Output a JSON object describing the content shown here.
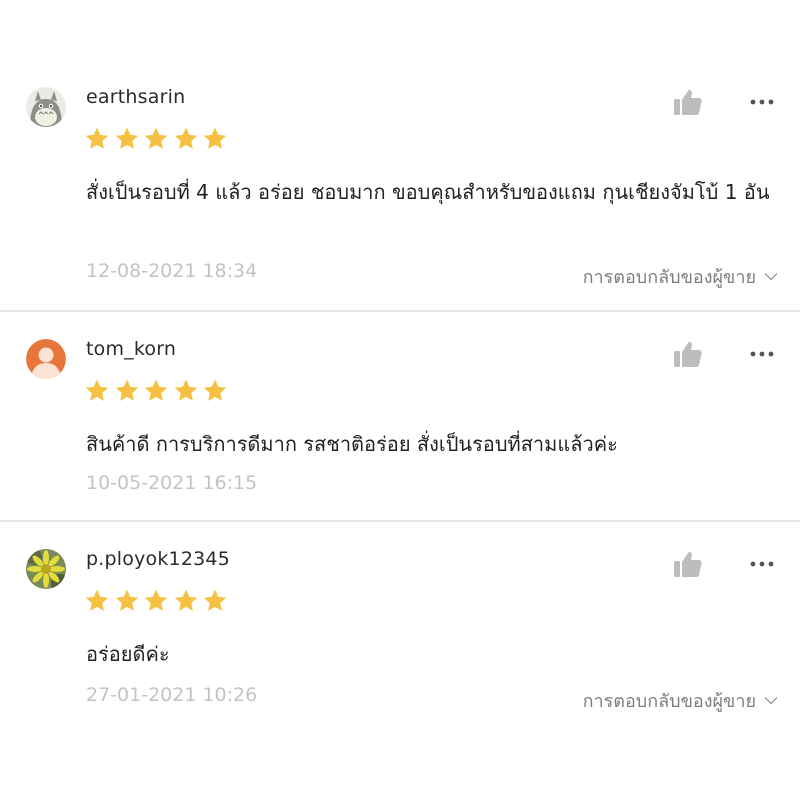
{
  "reviews": [
    {
      "username": "earthsarin",
      "rating": 5,
      "comment": "สั่งเป็นรอบที่ 4 แล้ว อร่อย ชอบมาก ขอบคุณสำหรับของแถม กุนเชียงจัมโบ้ 1 อัน",
      "timestamp": "12-08-2021 18:34",
      "seller_reply_label": "การตอบกลับของผู้ขาย",
      "avatar_icon": "totoro-avatar-icon"
    },
    {
      "username": "tom_korn",
      "rating": 5,
      "comment": "สินค้าดี การบริการดีมาก รสชาติอร่อย สั่งเป็นรอบที่สามแล้วค่ะ",
      "timestamp": "10-05-2021 16:15",
      "avatar_icon": "default-user-avatar-icon"
    },
    {
      "username": "p.ployok12345",
      "rating": 5,
      "comment": "อร่อยดีค่ะ",
      "timestamp": "27-01-2021 10:26",
      "seller_reply_label": "การตอบกลับของผู้ขาย",
      "avatar_icon": "flower-avatar-icon"
    }
  ],
  "colors": {
    "star": "#f6c143",
    "icon_gray": "#bdbdbd",
    "timestamp": "#c3c3c3",
    "divider": "#e6e6e6",
    "avatar_orange": "#e8753a"
  }
}
